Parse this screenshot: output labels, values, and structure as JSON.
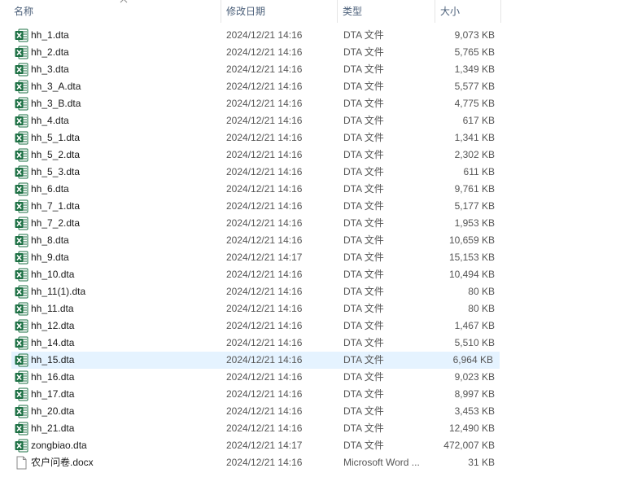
{
  "columns": {
    "name": "名称",
    "date": "修改日期",
    "type": "类型",
    "size": "大小"
  },
  "colors": {
    "excel_green": "#1e7145",
    "header_text": "#4c607a",
    "selected_row": "#e5f3ff"
  },
  "files": [
    {
      "name": "hh_1.dta",
      "date": "2024/12/21 14:16",
      "type": "DTA 文件",
      "size": "9,073 KB",
      "icon": "excel-file-icon"
    },
    {
      "name": "hh_2.dta",
      "date": "2024/12/21 14:16",
      "type": "DTA 文件",
      "size": "5,765 KB",
      "icon": "excel-file-icon"
    },
    {
      "name": "hh_3.dta",
      "date": "2024/12/21 14:16",
      "type": "DTA 文件",
      "size": "1,349 KB",
      "icon": "excel-file-icon"
    },
    {
      "name": "hh_3_A.dta",
      "date": "2024/12/21 14:16",
      "type": "DTA 文件",
      "size": "5,577 KB",
      "icon": "excel-file-icon"
    },
    {
      "name": "hh_3_B.dta",
      "date": "2024/12/21 14:16",
      "type": "DTA 文件",
      "size": "4,775 KB",
      "icon": "excel-file-icon"
    },
    {
      "name": "hh_4.dta",
      "date": "2024/12/21 14:16",
      "type": "DTA 文件",
      "size": "617 KB",
      "icon": "excel-file-icon"
    },
    {
      "name": "hh_5_1.dta",
      "date": "2024/12/21 14:16",
      "type": "DTA 文件",
      "size": "1,341 KB",
      "icon": "excel-file-icon"
    },
    {
      "name": "hh_5_2.dta",
      "date": "2024/12/21 14:16",
      "type": "DTA 文件",
      "size": "2,302 KB",
      "icon": "excel-file-icon"
    },
    {
      "name": "hh_5_3.dta",
      "date": "2024/12/21 14:16",
      "type": "DTA 文件",
      "size": "611 KB",
      "icon": "excel-file-icon"
    },
    {
      "name": "hh_6.dta",
      "date": "2024/12/21 14:16",
      "type": "DTA 文件",
      "size": "9,761 KB",
      "icon": "excel-file-icon"
    },
    {
      "name": "hh_7_1.dta",
      "date": "2024/12/21 14:16",
      "type": "DTA 文件",
      "size": "5,177 KB",
      "icon": "excel-file-icon"
    },
    {
      "name": "hh_7_2.dta",
      "date": "2024/12/21 14:16",
      "type": "DTA 文件",
      "size": "1,953 KB",
      "icon": "excel-file-icon"
    },
    {
      "name": "hh_8.dta",
      "date": "2024/12/21 14:16",
      "type": "DTA 文件",
      "size": "10,659 KB",
      "icon": "excel-file-icon"
    },
    {
      "name": "hh_9.dta",
      "date": "2024/12/21 14:17",
      "type": "DTA 文件",
      "size": "15,153 KB",
      "icon": "excel-file-icon"
    },
    {
      "name": "hh_10.dta",
      "date": "2024/12/21 14:16",
      "type": "DTA 文件",
      "size": "10,494 KB",
      "icon": "excel-file-icon"
    },
    {
      "name": "hh_11(1).dta",
      "date": "2024/12/21 14:16",
      "type": "DTA 文件",
      "size": "80 KB",
      "icon": "excel-file-icon"
    },
    {
      "name": "hh_11.dta",
      "date": "2024/12/21 14:16",
      "type": "DTA 文件",
      "size": "80 KB",
      "icon": "excel-file-icon"
    },
    {
      "name": "hh_12.dta",
      "date": "2024/12/21 14:16",
      "type": "DTA 文件",
      "size": "1,467 KB",
      "icon": "excel-file-icon"
    },
    {
      "name": "hh_14.dta",
      "date": "2024/12/21 14:16",
      "type": "DTA 文件",
      "size": "5,510 KB",
      "icon": "excel-file-icon"
    },
    {
      "name": "hh_15.dta",
      "date": "2024/12/21 14:16",
      "type": "DTA 文件",
      "size": "6,964 KB",
      "icon": "excel-file-icon",
      "selected": true
    },
    {
      "name": "hh_16.dta",
      "date": "2024/12/21 14:16",
      "type": "DTA 文件",
      "size": "9,023 KB",
      "icon": "excel-file-icon"
    },
    {
      "name": "hh_17.dta",
      "date": "2024/12/21 14:16",
      "type": "DTA 文件",
      "size": "8,997 KB",
      "icon": "excel-file-icon"
    },
    {
      "name": "hh_20.dta",
      "date": "2024/12/21 14:16",
      "type": "DTA 文件",
      "size": "3,453 KB",
      "icon": "excel-file-icon"
    },
    {
      "name": "hh_21.dta",
      "date": "2024/12/21 14:16",
      "type": "DTA 文件",
      "size": "12,490 KB",
      "icon": "excel-file-icon"
    },
    {
      "name": "zongbiao.dta",
      "date": "2024/12/21 14:17",
      "type": "DTA 文件",
      "size": "472,007 KB",
      "icon": "excel-file-icon"
    },
    {
      "name": "农户问卷.docx",
      "date": "2024/12/21 14:16",
      "type": "Microsoft Word ...",
      "size": "31 KB",
      "icon": "document-file-icon"
    }
  ]
}
